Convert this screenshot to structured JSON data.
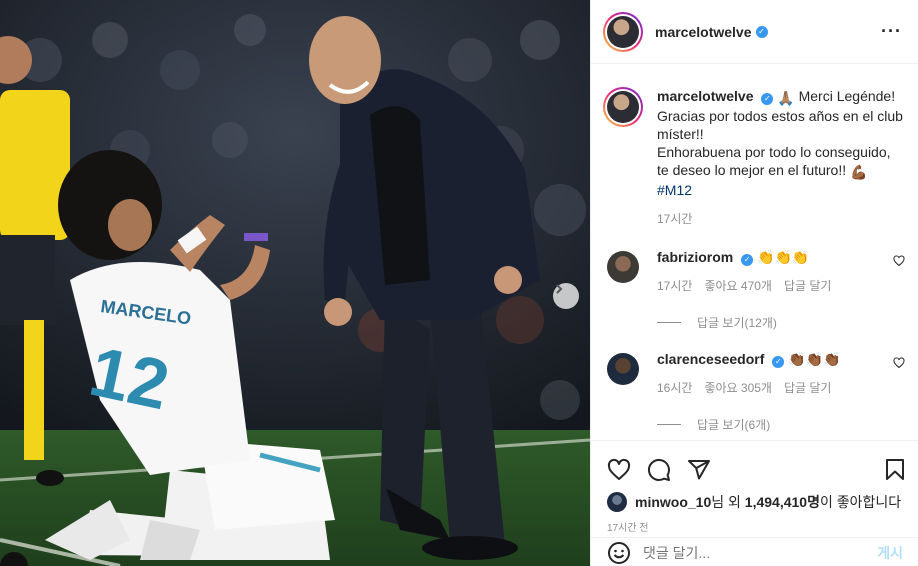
{
  "post": {
    "author": "marcelotwelve",
    "verified": true,
    "caption_emoji": "🙏🏽",
    "caption_lines": [
      "Merci Legénde!",
      "Gracias por todos estos años en el club",
      "míster!!",
      "Enhorabuena por todo lo conseguido,",
      "te deseo lo mejor en el futuro!!"
    ],
    "caption_end_emoji": "💪🏾",
    "hashtag": "#M12",
    "caption_time": "17시간",
    "more_icon": "more-horizontal-icon"
  },
  "comments": [
    {
      "author": "fabriziorom",
      "verified": true,
      "text": "👏👏👏",
      "time": "17시간",
      "likes": "좋아요 470개",
      "reply": "답글 달기",
      "view_replies": "답글 보기(12개)",
      "avatar_color": "#3d3a36"
    },
    {
      "author": "clarenceseedorf",
      "verified": true,
      "text": "👏🏾👏🏾👏🏾",
      "time": "16시간",
      "likes": "좋아요 305개",
      "reply": "답글 달기",
      "view_replies": "답글 보기(6개)",
      "avatar_color": "#1e2a3d"
    }
  ],
  "actions": {
    "icons": [
      "heart-icon",
      "comment-icon",
      "share-icon",
      "bookmark-icon"
    ],
    "liked_by_user": "minwoo_10",
    "liked_by_suffix": "님 외",
    "like_count": "1,494,410명",
    "like_suffix": "이 좋아합니다",
    "posted_time": "17시간 전"
  },
  "add_comment": {
    "placeholder": "댓글 달기...",
    "post_label": "게시"
  },
  "colors": {
    "accent_blue": "#3897f0",
    "hashtag": "#00376b",
    "muted": "#8e8e8e",
    "post_disabled": "#b2dffc"
  }
}
